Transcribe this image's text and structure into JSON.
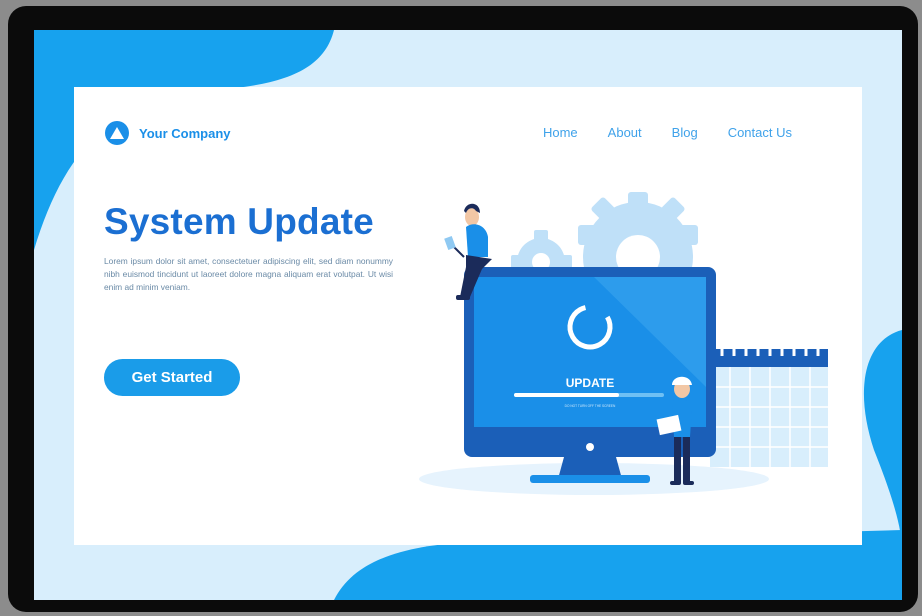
{
  "brand": {
    "name": "Your Company"
  },
  "nav": {
    "items": [
      "Home",
      "About",
      "Blog",
      "Contact Us"
    ]
  },
  "hero": {
    "title": "System Update",
    "body": "Lorem ipsum dolor sit amet, consectetuer adipiscing elit, sed diam nonummy nibh euismod tincidunt ut laoreet dolore magna aliquam erat volutpat. Ut wisi enim ad minim veniam.",
    "cta_label": "Get Started"
  },
  "illustration": {
    "screen_label": "UPDATE",
    "screen_sublabel": "DO NOT TURN OFF THE SCREEN",
    "progress": 0.7
  },
  "colors": {
    "primary": "#1b6fd2",
    "accent": "#1a9ce9",
    "light": "#d8eefc",
    "monitor": "#1b5fb8"
  }
}
